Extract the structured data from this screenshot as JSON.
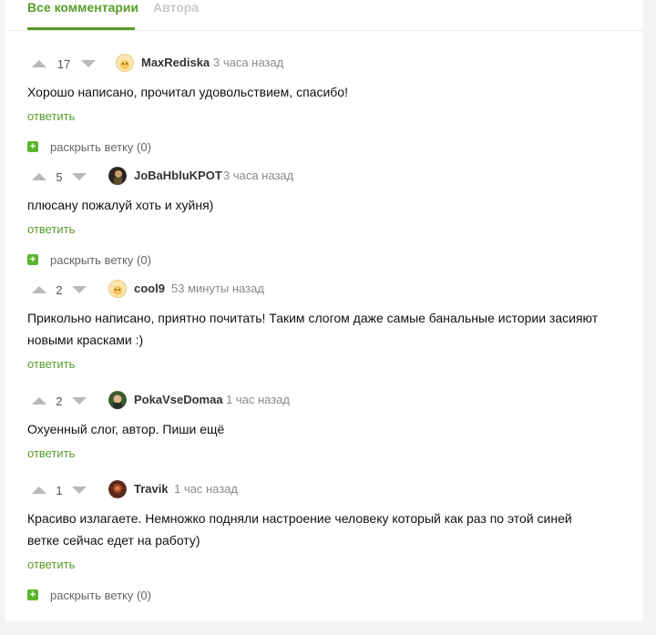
{
  "tabs": [
    {
      "label": "Все комментарии"
    },
    {
      "label": "Авторa"
    }
  ],
  "comments": [
    {
      "score": "17",
      "author": "MaxRediska",
      "time": "3 часа назад",
      "text_lines": [
        "Хорошо написано, прочитал удовольствием, спасибо!"
      ],
      "reply_label": "ответить",
      "avatar_icon": "tomato-face-avatar-icon",
      "expand_label": "раскрыть ветку (0)"
    },
    {
      "score": "5",
      "author": "JoBaHbluKPOT",
      "time": "3 часа назад",
      "text_lines": [
        "плюсану пожалуй хоть и хуйня)"
      ],
      "reply_label": "ответить",
      "avatar_icon": "photo-avatar-icon",
      "expand_label": "раскрыть ветку (0)"
    },
    {
      "score": "2",
      "author": "cool9",
      "time": "53 минуты назад",
      "text_lines": [
        "Прикольно написано, приятно почитать! Таким слогом даже самые банальные истории засияют",
        "новыми красками :)"
      ],
      "reply_label": "ответить",
      "avatar_icon": "tomato-face-avatar-icon"
    },
    {
      "score": "2",
      "author": "PokaVseDomaa",
      "time": "1 час назад",
      "text_lines": [
        "Охуенный слог, автор. Пиши ещё"
      ],
      "reply_label": "ответить",
      "avatar_icon": "photo-avatar-icon"
    },
    {
      "score": "1",
      "author": "Travik",
      "time": "1 час назад",
      "text_lines": [
        "Красиво излагаете. Немножко подняли настроение человеку который как раз по этой синей",
        "ветке сейчас едет на работу)"
      ],
      "reply_label": "ответить",
      "avatar_icon": "photo-avatar-icon",
      "expand_label": "раскрыть ветку (0)"
    }
  ],
  "colors": {
    "accent": "#5a9c2a",
    "expand_icon": "#5cb531",
    "vote_arrow": "#b9b9b9"
  }
}
